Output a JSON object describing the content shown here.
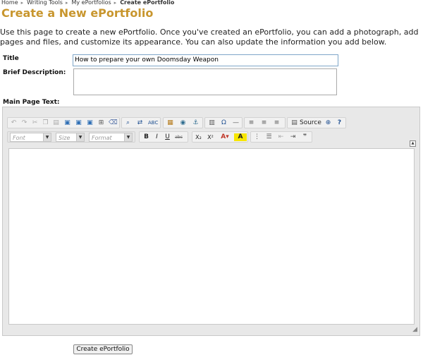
{
  "breadcrumb": {
    "items": [
      "Home",
      "Writing Tools",
      "My ePortfolios"
    ],
    "current": "Create ePortfolio"
  },
  "page": {
    "title": "Create a New ePortfolio",
    "intro": "Use this page to create a new ePortfolio. Once you've created an ePortfolio, you can add a photograph, add pages and files, and customize its appearance. You can also update the information you add below."
  },
  "form": {
    "title_label": "Title",
    "title_value": "How to prepare your own Doomsday Weapon",
    "description_label": "Brief Description:",
    "description_value": "",
    "main_text_label": "Main Page Text:"
  },
  "editor": {
    "source_label": "Source",
    "font_placeholder": "Font",
    "size_placeholder": "Size",
    "format_placeholder": "Format"
  },
  "actions": {
    "create_button": "Create ePortfolio"
  },
  "colors": {
    "heading": "#c8962e",
    "input_border_focus": "#7fa6c9"
  }
}
